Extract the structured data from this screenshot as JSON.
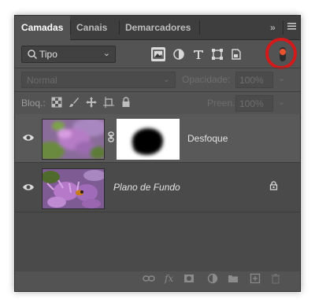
{
  "tabs": [
    {
      "label": "Camadas",
      "active": true
    },
    {
      "label": "Canais",
      "active": false
    },
    {
      "label": "Demarcadores",
      "active": false
    }
  ],
  "tabbar_icons": [
    "expand-arrows-icon",
    "panel-menu-icon"
  ],
  "filter": {
    "kind_label": "Tipo",
    "icons": [
      "pixel-layer-filter-icon",
      "adjustment-layer-filter-icon",
      "type-layer-filter-icon",
      "shape-layer-filter-icon",
      "smart-object-filter-icon"
    ],
    "toggle_color": "#e8532e",
    "highlight_color": "#d21a1a"
  },
  "blend": {
    "mode": "Normal",
    "opacity_label": "Opacidade:",
    "opacity_value": "100%"
  },
  "lock": {
    "label": "Bloq.:",
    "icons": [
      "lock-transparent-pixels-icon",
      "lock-image-pixels-icon",
      "lock-position-icon",
      "lock-artboard-icon",
      "lock-all-icon"
    ],
    "fill_label": "Preen.:",
    "fill_value": "100%"
  },
  "layers": [
    {
      "name": "Desfoque",
      "selected": true,
      "has_mask": true,
      "locked": false
    },
    {
      "name": "Plano de Fundo",
      "selected": false,
      "has_mask": false,
      "locked": true
    }
  ],
  "bottom_icons": [
    "link-layers-icon",
    "layer-style-fx-icon",
    "add-mask-icon",
    "new-adjustment-icon",
    "new-group-icon",
    "new-layer-icon",
    "delete-layer-icon"
  ]
}
